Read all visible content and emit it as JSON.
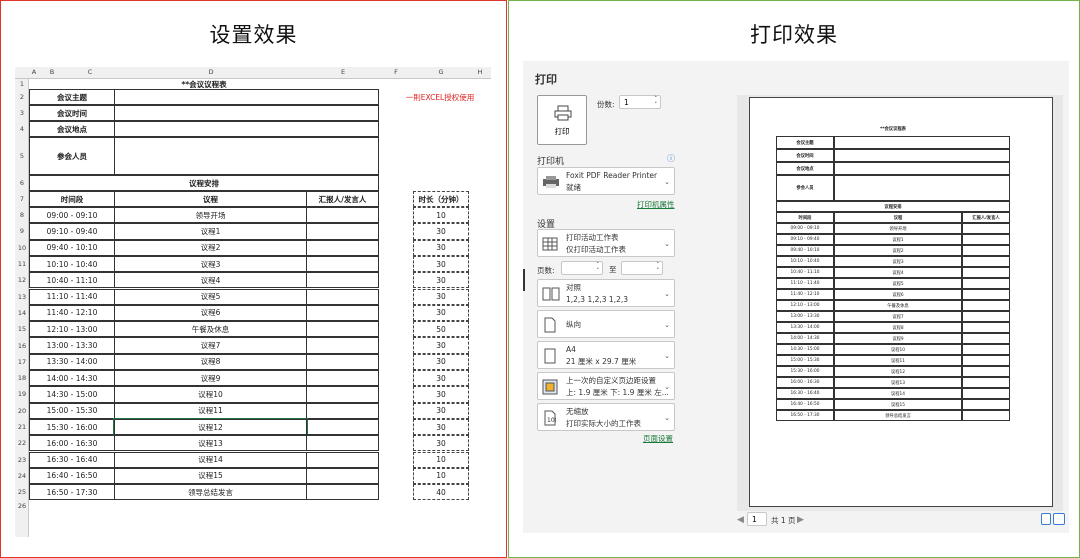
{
  "left_title": "设置效果",
  "right_title": "打印效果",
  "excel": {
    "columns": [
      "A",
      "B",
      "C",
      "D",
      "E",
      "F",
      "G",
      "H"
    ],
    "row_numbers": [
      "1",
      "2",
      "3",
      "4",
      "5",
      "6",
      "7",
      "8",
      "9",
      "10",
      "11",
      "12",
      "13",
      "14",
      "15",
      "16",
      "17",
      "18",
      "19",
      "20",
      "21",
      "22",
      "23",
      "24",
      "25",
      "26"
    ],
    "title": "**会议议程表",
    "note": "一則EXCEL授权使用",
    "info_labels": [
      "会议主题",
      "会议时间",
      "会议地点",
      "参会人员"
    ],
    "section": "议程安排",
    "headers": {
      "time": "时间段",
      "item": "议程",
      "reporter": "汇报人/发言人",
      "duration": "时长（分钟）"
    },
    "rows": [
      {
        "time": "09:00 - 09:10",
        "item": "领导开场",
        "dur": "10"
      },
      {
        "time": "09:10 - 09:40",
        "item": "议程1",
        "dur": "30"
      },
      {
        "time": "09:40 - 10:10",
        "item": "议程2",
        "dur": "30"
      },
      {
        "time": "10:10 - 10:40",
        "item": "议程3",
        "dur": "30"
      },
      {
        "time": "10:40 - 11:10",
        "item": "议程4",
        "dur": "30"
      },
      {
        "time": "11:10 - 11:40",
        "item": "议程5",
        "dur": "30"
      },
      {
        "time": "11:40 - 12:10",
        "item": "议程6",
        "dur": "30"
      },
      {
        "time": "12:10 - 13:00",
        "item": "午餐及休息",
        "dur": "50"
      },
      {
        "time": "13:00 - 13:30",
        "item": "议程7",
        "dur": "30"
      },
      {
        "time": "13:30 - 14:00",
        "item": "议程8",
        "dur": "30"
      },
      {
        "time": "14:00 - 14:30",
        "item": "议程9",
        "dur": "30"
      },
      {
        "time": "14:30 - 15:00",
        "item": "议程10",
        "dur": "30"
      },
      {
        "time": "15:00 - 15:30",
        "item": "议程11",
        "dur": "30"
      },
      {
        "time": "15:30 - 16:00",
        "item": "议程12",
        "dur": "30"
      },
      {
        "time": "16:00 - 16:30",
        "item": "议程13",
        "dur": "30"
      },
      {
        "time": "16:30 - 16:40",
        "item": "议程14",
        "dur": "10"
      },
      {
        "time": "16:40 - 16:50",
        "item": "议程15",
        "dur": "10"
      },
      {
        "time": "16:50 - 17:30",
        "item": "领导总结发言",
        "dur": "40"
      }
    ]
  },
  "print": {
    "heading": "打印",
    "print_button": "打印",
    "copies_label": "份数:",
    "copies_value": "1",
    "printer_label": "打印机",
    "printer_name": "Foxit PDF Reader Printer",
    "printer_status": "就绪",
    "printer_props": "打印机属性",
    "settings_label": "设置",
    "opt_scope": [
      "打印活动工作表",
      "仅打印活动工作表"
    ],
    "pages_label": "页数:",
    "pages_to": "至",
    "opt_collate": [
      "对照",
      "1,2,3    1,2,3    1,2,3"
    ],
    "opt_orient": "纵向",
    "opt_paper": [
      "A4",
      "21 厘米 x 29.7 厘米"
    ],
    "opt_margin": [
      "上一次的自定义页边距设置",
      "上: 1.9 厘米 下: 1.9 厘米 左..."
    ],
    "opt_scale": [
      "无缩放",
      "打印实际大小的工作表"
    ],
    "page_setup": "页面设置",
    "page_current": "1",
    "page_total": "共 1 页"
  },
  "colors": {
    "left_border": "#e0342c",
    "right_border": "#74b44a",
    "note": "#e02020",
    "link": "#1a7a3a"
  }
}
